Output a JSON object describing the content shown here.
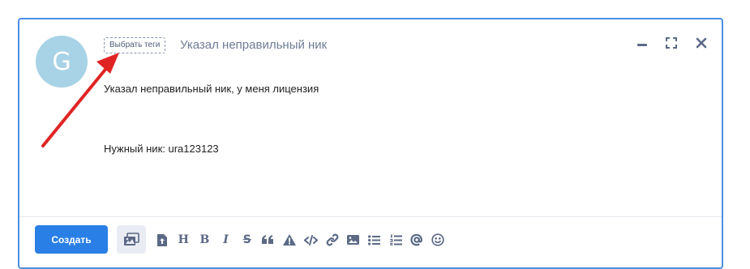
{
  "ticket": {
    "avatar_letter": "G",
    "tags_button_label": "Выбрать теги",
    "subject": "Указал неправильный ник",
    "body_lines": [
      "Указал неправильный ник, у меня лицензия",
      "",
      "Нужный ник: ura123123"
    ]
  },
  "footer": {
    "create_label": "Создать"
  },
  "toolbar": {
    "heading_glyph": "H",
    "bold_glyph": "B",
    "italic_glyph": "I",
    "strike_glyph": "S"
  },
  "colors": {
    "accent": "#2a7fe6",
    "border": "#4a90e2",
    "avatar": "#a8d3e6",
    "icon": "#5b6985",
    "annotation_arrow": "#e02424"
  },
  "icons": [
    "minimize-icon",
    "expand-icon",
    "close-icon",
    "gallery-icon",
    "upload-file-icon",
    "quote-icon",
    "warning-icon",
    "code-icon",
    "link-icon",
    "image-icon",
    "bullet-list-icon",
    "numbered-list-icon",
    "mention-icon",
    "emoji-icon"
  ]
}
